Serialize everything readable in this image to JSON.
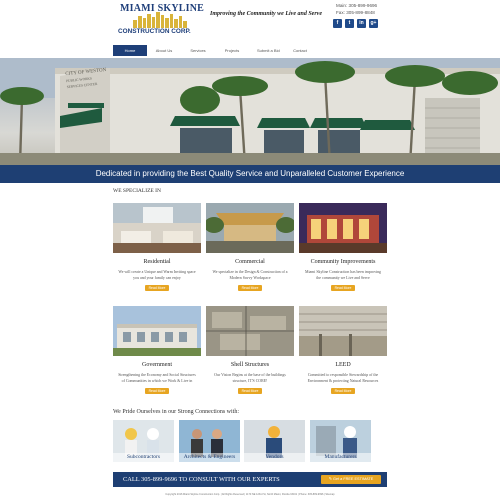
{
  "header": {
    "logo_top": "MIAMI SKYLINE",
    "logo_bottom": "CONSTRUCTION CORP.",
    "tagline": "Improving the Community we Live and Serve",
    "phone": "Main: 305-899-9696",
    "fax": "Fax: 305-899-8848",
    "social": [
      {
        "icon": "facebook-icon",
        "glyph": "f"
      },
      {
        "icon": "twitter-icon",
        "glyph": "t"
      },
      {
        "icon": "linkedin-icon",
        "glyph": "in"
      },
      {
        "icon": "google-plus-icon",
        "glyph": "g+"
      }
    ]
  },
  "nav": {
    "items": [
      "Home",
      "About Us",
      "Services",
      "Projects",
      "Submit a Bid",
      "Contact"
    ],
    "active": "Home"
  },
  "hero": {
    "banner": "Dedicated in providing the Best Quality Service and Unparalleled Customer Experience",
    "sign_lines": [
      "CITY OF WESTON",
      "PUBLIC WORKS",
      "SERVICES CENTER"
    ]
  },
  "specialize": {
    "title": "WE SPECIALIZE IN",
    "button_label": "Read More",
    "cards": [
      {
        "title": "Residential",
        "desc": "We will create a Unique and Warm Inviting space you and your family can enjoy"
      },
      {
        "title": "Commercial",
        "desc": "We specialize in the Design & Construction of a Modern Savvy Workspace"
      },
      {
        "title": "Community Improvements",
        "desc": "Miami Skyline Construction has been improving the community we Live and Serve"
      },
      {
        "title": "Government",
        "desc": "Strengthening the Economy and Social Structures of Communities in which we Work & Live in"
      },
      {
        "title": "Shell Structures",
        "desc": "Our Vision Begins at the base of the buildings structure, IT'S CORE!"
      },
      {
        "title": "LEED",
        "desc": "Committed to responsible Stewardship of the Environment & protecting Natural Resources"
      }
    ]
  },
  "connections": {
    "title": "We Pride Ourselves in our Strong Connections with:",
    "items": [
      "Subcontractors",
      "Architects & Engineers",
      "Vendors",
      "Manufacturers"
    ]
  },
  "cta": {
    "text": "CALL 305-899-9696 TO CONSULT WITH OUR EXPERTS",
    "button": "Get a FREE ESTIMATE"
  },
  "footer": {
    "text": "Copyright 2016 Miami Skyline Construction Corp. | All Rights Reserved | 1170 NE 123rd St, North Miami, Florida 33161 | Phone: 305-899-9696 | Sitemap"
  },
  "colors": {
    "navy": "#1e3f73",
    "orange": "#e7a521",
    "logo_gold": "#d9b43a"
  }
}
